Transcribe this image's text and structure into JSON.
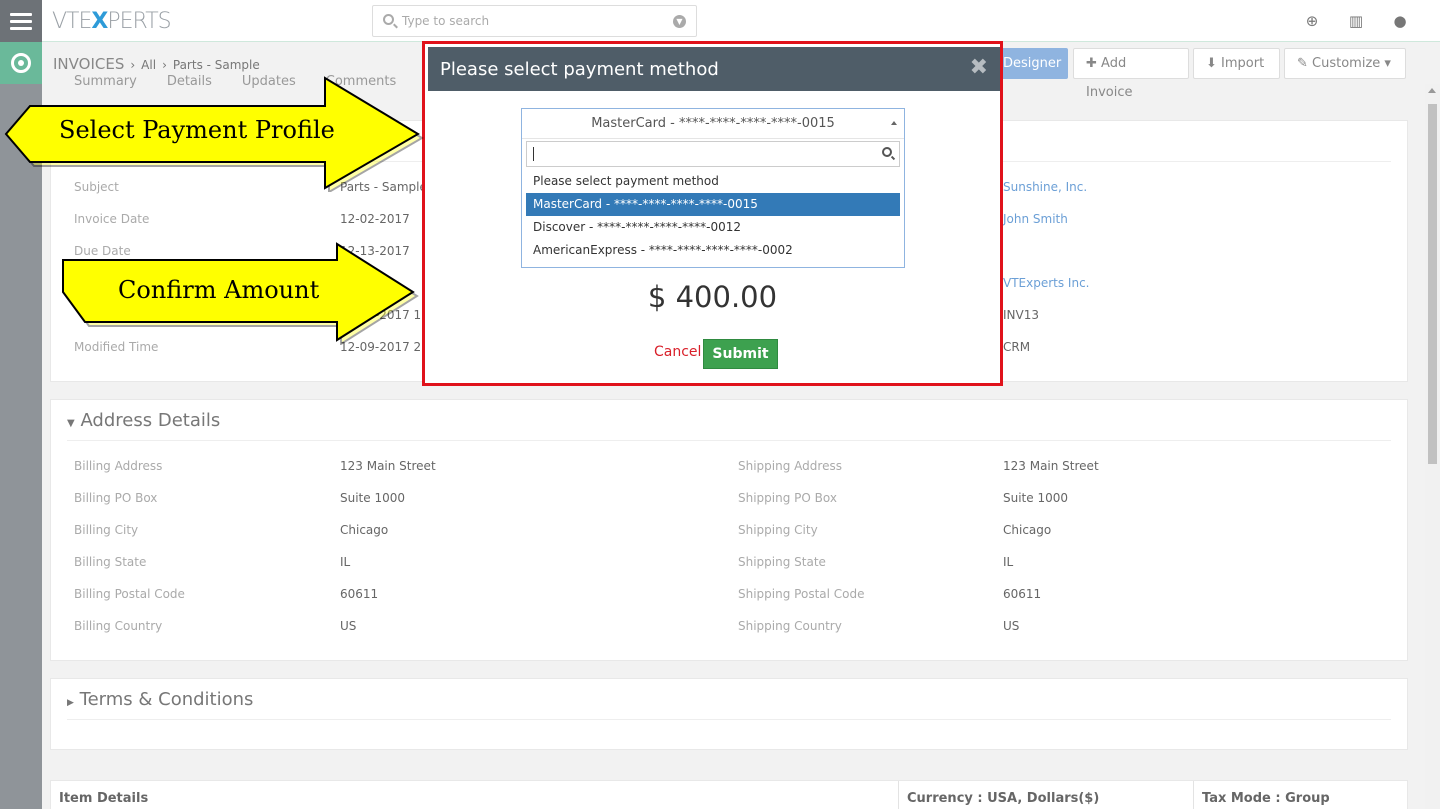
{
  "app": {
    "logo_prefix": "VTE",
    "logo_x": "X",
    "logo_suffix": "PERTS"
  },
  "search": {
    "placeholder": "Type to search"
  },
  "breadcrumb": {
    "module": "INVOICES",
    "level1": "All",
    "level2": "Parts - Sample"
  },
  "actions": {
    "designer": "Designer",
    "add": "Add Invoice",
    "import": "Import",
    "customize": "Customize"
  },
  "tabs": [
    "Summary",
    "Details",
    "Updates",
    "Comments"
  ],
  "info_fields": [
    {
      "label": "Subject",
      "value": "Parts - Sample",
      "right_value": "Sunshine, Inc."
    },
    {
      "label": "Invoice Date",
      "value": "12-02-2017",
      "right_value": "John Smith"
    },
    {
      "label": "Due Date",
      "value": "12-13-2017",
      "right_value": ""
    },
    {
      "label": "",
      "value": "",
      "right_value": "VTExperts Inc."
    },
    {
      "label": "",
      "value": "12-09-2017 1:",
      "right_value": "INV13"
    },
    {
      "label": "Modified Time",
      "value": "12-09-2017 2:",
      "right_value": "CRM"
    }
  ],
  "address": {
    "title": "Address Details",
    "rows": [
      {
        "l_label": "Billing Address",
        "l_value": "123 Main Street",
        "r_label": "Shipping Address",
        "r_value": "123 Main Street"
      },
      {
        "l_label": "Billing PO Box",
        "l_value": "Suite 1000",
        "r_label": "Shipping PO Box",
        "r_value": "Suite 1000"
      },
      {
        "l_label": "Billing City",
        "l_value": "Chicago",
        "r_label": "Shipping City",
        "r_value": "Chicago"
      },
      {
        "l_label": "Billing State",
        "l_value": "IL",
        "r_label": "Shipping State",
        "r_value": "IL"
      },
      {
        "l_label": "Billing Postal Code",
        "l_value": "60611",
        "r_label": "Shipping Postal Code",
        "r_value": "60611"
      },
      {
        "l_label": "Billing Country",
        "l_value": "US",
        "r_label": "Shipping Country",
        "r_value": "US"
      }
    ]
  },
  "terms": {
    "title": "Terms & Conditions"
  },
  "items_table": {
    "col1": "Item Details",
    "col2": "Currency : USA, Dollars($)",
    "col3": "Tax Mode : Group"
  },
  "modal": {
    "title": "Please select payment method",
    "selected": "MasterCard - ****-****-****-****-0015",
    "options": [
      "Please select payment method",
      "MasterCard - ****-****-****-****-0015",
      "Discover - ****-****-****-****-0012",
      "AmericanExpress - ****-****-****-****-0002"
    ],
    "selected_index": 1,
    "amount": "$ 400.00",
    "cancel": "Cancel",
    "submit": "Submit"
  },
  "callouts": {
    "first": "Select Payment Profile",
    "second": "Confirm Amount"
  },
  "colors": {
    "accent": "#337ab7",
    "alert_border": "#e0121b",
    "submit": "#3da14f",
    "arrow_fill": "#ffff00"
  }
}
